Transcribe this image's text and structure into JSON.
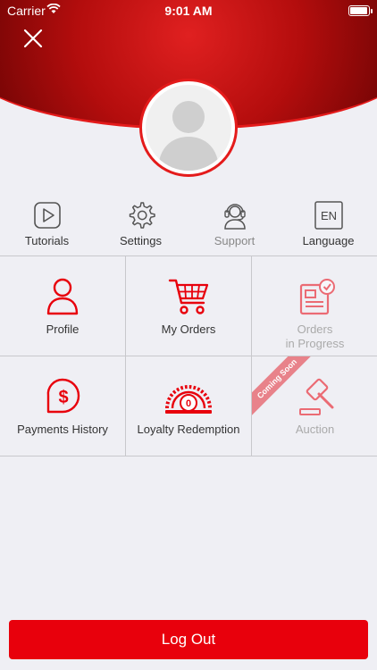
{
  "status_bar": {
    "carrier": "Carrier",
    "time": "9:01 AM"
  },
  "quick_actions": [
    {
      "label": "Tutorials",
      "icon": "play-icon"
    },
    {
      "label": "Settings",
      "icon": "gear-icon"
    },
    {
      "label": "Support",
      "icon": "headset-icon"
    },
    {
      "label": "Language",
      "icon": "language-icon",
      "badge": "EN"
    }
  ],
  "grid": [
    {
      "label": "Profile",
      "icon": "user-icon"
    },
    {
      "label": "My Orders",
      "icon": "cart-icon"
    },
    {
      "label_line1": "Orders",
      "label_line2": "in Progress",
      "icon": "order-progress-icon",
      "enabled": false
    },
    {
      "label": "Payments History",
      "icon": "dollar-bubble-icon"
    },
    {
      "label": "Loyalty Redemption",
      "icon": "loyalty-gauge-icon",
      "badge": "0"
    },
    {
      "label": "Auction",
      "icon": "gavel-icon",
      "enabled": false,
      "ribbon": "Coming Soon"
    }
  ],
  "logout_label": "Log Out",
  "colors": {
    "accent": "#e8000c",
    "disabled": "#e8828a"
  }
}
